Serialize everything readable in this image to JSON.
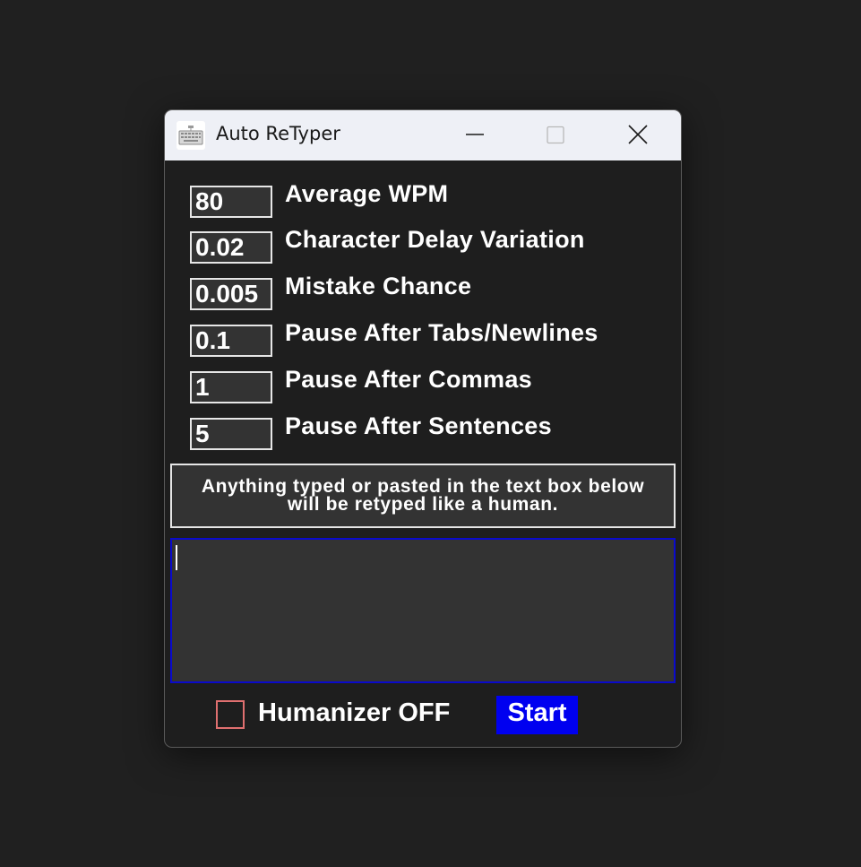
{
  "window": {
    "title": "Auto ReTyper",
    "app_icon": "keyboard-icon",
    "controls": {
      "minimize_icon": "minimize-icon",
      "maximize_icon": "maximize-icon",
      "close_icon": "close-icon"
    }
  },
  "settings": [
    {
      "value": "80",
      "label": "Average WPM"
    },
    {
      "value": "0.02",
      "label": "Character Delay Variation"
    },
    {
      "value": "0.005",
      "label": "Mistake Chance"
    },
    {
      "value": "0.1",
      "label": "Pause After Tabs/Newlines"
    },
    {
      "value": "1",
      "label": "Pause After Commas"
    },
    {
      "value": "5",
      "label": "Pause After Sentences"
    }
  ],
  "info": {
    "line1": "Anything typed or pasted in the text box below",
    "line2": "will be retyped like a human."
  },
  "text_box": {
    "value": ""
  },
  "humanizer": {
    "label": "Humanizer OFF",
    "checked": false
  },
  "start_button": {
    "label": "Start"
  },
  "colors": {
    "background": "#202020",
    "window_bg": "#1e1e1e",
    "field_bg": "#333333",
    "text_box_border": "#0a0acc",
    "start_button_bg": "#0000f0",
    "checkbox_border": "#e07070"
  }
}
